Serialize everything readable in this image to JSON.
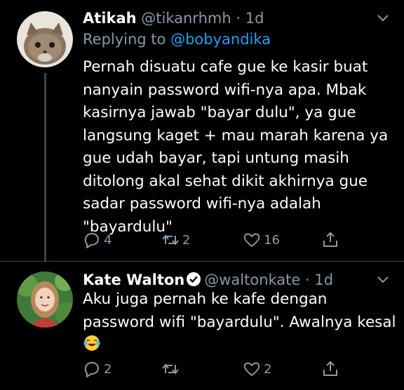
{
  "tweets": [
    {
      "name": "Atikah",
      "handle": "@tikanrhmh",
      "dot": "·",
      "time": "1d",
      "reply_prefix": "Replying to",
      "reply_to": "@bobyandika",
      "text_lines": [
        "Pernah disuatu cafe gue ke kasir buat",
        "nanyain password wifi-nya apa. Mbak",
        "kasirnya jawab \"bayar dulu\", ya gue",
        "langsung kaget + mau marah karena ya",
        "gue udah bayar, tapi untung masih",
        "ditolong akal sehat dikit akhirnya gue",
        "sadar password wifi-nya adalah",
        "\"bayardulu\""
      ],
      "replies": "4",
      "retweets": "2",
      "likes": "16"
    },
    {
      "name": "Kate Walton",
      "handle": "@waltonkate",
      "dot": "·",
      "time": "1d",
      "text_lines": [
        "Aku juga pernah ke kafe dengan",
        "password wifi \"bayardulu\". Awalnya kesal"
      ],
      "emoji": "face-with-tears-of-joy",
      "replies": "2",
      "retweets": "",
      "likes": "2"
    }
  ],
  "colors": {
    "background": "#000000",
    "secondary_text": "#8899a6",
    "link": "#1da1f2",
    "verified_badge": "#ffffff"
  }
}
